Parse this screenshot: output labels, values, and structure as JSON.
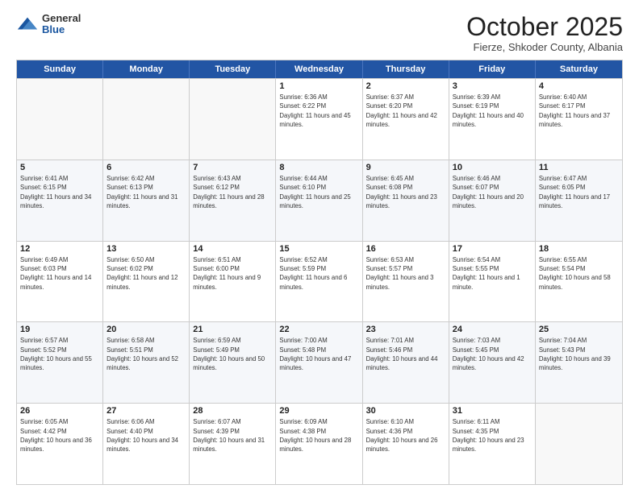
{
  "header": {
    "logo": {
      "general": "General",
      "blue": "Blue"
    },
    "title": "October 2025",
    "subtitle": "Fierze, Shkoder County, Albania"
  },
  "days_of_week": [
    "Sunday",
    "Monday",
    "Tuesday",
    "Wednesday",
    "Thursday",
    "Friday",
    "Saturday"
  ],
  "weeks": [
    [
      {
        "day": "",
        "empty": true
      },
      {
        "day": "",
        "empty": true
      },
      {
        "day": "",
        "empty": true
      },
      {
        "day": "1",
        "sunrise": "Sunrise: 6:36 AM",
        "sunset": "Sunset: 6:22 PM",
        "daylight": "Daylight: 11 hours and 45 minutes."
      },
      {
        "day": "2",
        "sunrise": "Sunrise: 6:37 AM",
        "sunset": "Sunset: 6:20 PM",
        "daylight": "Daylight: 11 hours and 42 minutes."
      },
      {
        "day": "3",
        "sunrise": "Sunrise: 6:39 AM",
        "sunset": "Sunset: 6:19 PM",
        "daylight": "Daylight: 11 hours and 40 minutes."
      },
      {
        "day": "4",
        "sunrise": "Sunrise: 6:40 AM",
        "sunset": "Sunset: 6:17 PM",
        "daylight": "Daylight: 11 hours and 37 minutes."
      }
    ],
    [
      {
        "day": "5",
        "sunrise": "Sunrise: 6:41 AM",
        "sunset": "Sunset: 6:15 PM",
        "daylight": "Daylight: 11 hours and 34 minutes."
      },
      {
        "day": "6",
        "sunrise": "Sunrise: 6:42 AM",
        "sunset": "Sunset: 6:13 PM",
        "daylight": "Daylight: 11 hours and 31 minutes."
      },
      {
        "day": "7",
        "sunrise": "Sunrise: 6:43 AM",
        "sunset": "Sunset: 6:12 PM",
        "daylight": "Daylight: 11 hours and 28 minutes."
      },
      {
        "day": "8",
        "sunrise": "Sunrise: 6:44 AM",
        "sunset": "Sunset: 6:10 PM",
        "daylight": "Daylight: 11 hours and 25 minutes."
      },
      {
        "day": "9",
        "sunrise": "Sunrise: 6:45 AM",
        "sunset": "Sunset: 6:08 PM",
        "daylight": "Daylight: 11 hours and 23 minutes."
      },
      {
        "day": "10",
        "sunrise": "Sunrise: 6:46 AM",
        "sunset": "Sunset: 6:07 PM",
        "daylight": "Daylight: 11 hours and 20 minutes."
      },
      {
        "day": "11",
        "sunrise": "Sunrise: 6:47 AM",
        "sunset": "Sunset: 6:05 PM",
        "daylight": "Daylight: 11 hours and 17 minutes."
      }
    ],
    [
      {
        "day": "12",
        "sunrise": "Sunrise: 6:49 AM",
        "sunset": "Sunset: 6:03 PM",
        "daylight": "Daylight: 11 hours and 14 minutes."
      },
      {
        "day": "13",
        "sunrise": "Sunrise: 6:50 AM",
        "sunset": "Sunset: 6:02 PM",
        "daylight": "Daylight: 11 hours and 12 minutes."
      },
      {
        "day": "14",
        "sunrise": "Sunrise: 6:51 AM",
        "sunset": "Sunset: 6:00 PM",
        "daylight": "Daylight: 11 hours and 9 minutes."
      },
      {
        "day": "15",
        "sunrise": "Sunrise: 6:52 AM",
        "sunset": "Sunset: 5:59 PM",
        "daylight": "Daylight: 11 hours and 6 minutes."
      },
      {
        "day": "16",
        "sunrise": "Sunrise: 6:53 AM",
        "sunset": "Sunset: 5:57 PM",
        "daylight": "Daylight: 11 hours and 3 minutes."
      },
      {
        "day": "17",
        "sunrise": "Sunrise: 6:54 AM",
        "sunset": "Sunset: 5:55 PM",
        "daylight": "Daylight: 11 hours and 1 minute."
      },
      {
        "day": "18",
        "sunrise": "Sunrise: 6:55 AM",
        "sunset": "Sunset: 5:54 PM",
        "daylight": "Daylight: 10 hours and 58 minutes."
      }
    ],
    [
      {
        "day": "19",
        "sunrise": "Sunrise: 6:57 AM",
        "sunset": "Sunset: 5:52 PM",
        "daylight": "Daylight: 10 hours and 55 minutes."
      },
      {
        "day": "20",
        "sunrise": "Sunrise: 6:58 AM",
        "sunset": "Sunset: 5:51 PM",
        "daylight": "Daylight: 10 hours and 52 minutes."
      },
      {
        "day": "21",
        "sunrise": "Sunrise: 6:59 AM",
        "sunset": "Sunset: 5:49 PM",
        "daylight": "Daylight: 10 hours and 50 minutes."
      },
      {
        "day": "22",
        "sunrise": "Sunrise: 7:00 AM",
        "sunset": "Sunset: 5:48 PM",
        "daylight": "Daylight: 10 hours and 47 minutes."
      },
      {
        "day": "23",
        "sunrise": "Sunrise: 7:01 AM",
        "sunset": "Sunset: 5:46 PM",
        "daylight": "Daylight: 10 hours and 44 minutes."
      },
      {
        "day": "24",
        "sunrise": "Sunrise: 7:03 AM",
        "sunset": "Sunset: 5:45 PM",
        "daylight": "Daylight: 10 hours and 42 minutes."
      },
      {
        "day": "25",
        "sunrise": "Sunrise: 7:04 AM",
        "sunset": "Sunset: 5:43 PM",
        "daylight": "Daylight: 10 hours and 39 minutes."
      }
    ],
    [
      {
        "day": "26",
        "sunrise": "Sunrise: 6:05 AM",
        "sunset": "Sunset: 4:42 PM",
        "daylight": "Daylight: 10 hours and 36 minutes."
      },
      {
        "day": "27",
        "sunrise": "Sunrise: 6:06 AM",
        "sunset": "Sunset: 4:40 PM",
        "daylight": "Daylight: 10 hours and 34 minutes."
      },
      {
        "day": "28",
        "sunrise": "Sunrise: 6:07 AM",
        "sunset": "Sunset: 4:39 PM",
        "daylight": "Daylight: 10 hours and 31 minutes."
      },
      {
        "day": "29",
        "sunrise": "Sunrise: 6:09 AM",
        "sunset": "Sunset: 4:38 PM",
        "daylight": "Daylight: 10 hours and 28 minutes."
      },
      {
        "day": "30",
        "sunrise": "Sunrise: 6:10 AM",
        "sunset": "Sunset: 4:36 PM",
        "daylight": "Daylight: 10 hours and 26 minutes."
      },
      {
        "day": "31",
        "sunrise": "Sunrise: 6:11 AM",
        "sunset": "Sunset: 4:35 PM",
        "daylight": "Daylight: 10 hours and 23 minutes."
      },
      {
        "day": "",
        "empty": true
      }
    ]
  ]
}
